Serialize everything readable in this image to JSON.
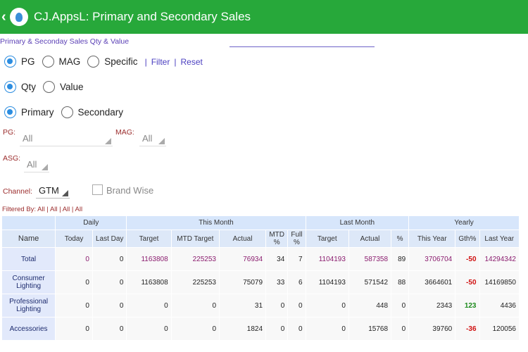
{
  "appbar": {
    "back": "‹",
    "title": "CJ.AppsL: Primary and Secondary Sales"
  },
  "subtitle": "Primary & Seconday Sales Qty & Value",
  "radios": {
    "level": [
      {
        "label": "PG",
        "checked": true
      },
      {
        "label": "MAG",
        "checked": false
      },
      {
        "label": "Specific",
        "checked": false
      }
    ],
    "filter_link": "Filter",
    "separator": "|",
    "reset_link": "Reset",
    "measure": [
      {
        "label": "Qty",
        "checked": true
      },
      {
        "label": "Value",
        "checked": false
      }
    ],
    "sales_type": [
      {
        "label": "Primary",
        "checked": true
      },
      {
        "label": "Secondary",
        "checked": false
      }
    ]
  },
  "filters": {
    "pg_label": "PG:",
    "pg_value": "All",
    "mag_label": "MAG:",
    "mag_value": "All",
    "asg_label": "ASG:",
    "asg_value": "All",
    "channel_label": "Channel:",
    "channel_value": "GTM",
    "brand_wise_label": "Brand Wise",
    "filtered_by": "Filtered By: All | All | All | All"
  },
  "table": {
    "groups": [
      "Daily",
      "This Month",
      "Last Month",
      "Yearly"
    ],
    "columns": [
      "Name",
      "Today",
      "Last Day",
      "Target",
      "MTD Target",
      "Actual",
      "MTD %",
      "Full %",
      "Target",
      "Actual",
      "%",
      "This Year",
      "Gth%",
      "Last Year"
    ],
    "rows": [
      [
        "Total",
        "0",
        "0",
        "1163808",
        "225253",
        "76934",
        "34",
        "7",
        "1104193",
        "587358",
        "89",
        "3706704",
        "-50",
        "14294342"
      ],
      [
        "Consumer Lighting",
        "0",
        "0",
        "1163808",
        "225253",
        "75079",
        "33",
        "6",
        "1104193",
        "571542",
        "88",
        "3664601",
        "-50",
        "14169850"
      ],
      [
        "Professional Lighting",
        "0",
        "0",
        "0",
        "0",
        "31",
        "0",
        "0",
        "0",
        "448",
        "0",
        "2343",
        "123",
        "4436"
      ],
      [
        "Accessories",
        "0",
        "0",
        "0",
        "0",
        "1824",
        "0",
        "0",
        "0",
        "15768",
        "0",
        "39760",
        "-36",
        "120056"
      ]
    ]
  },
  "colors": {
    "appbar": "#27a83a",
    "accent": "#2c8de0",
    "negative": "#d01010",
    "positive": "#1c8a1c"
  }
}
